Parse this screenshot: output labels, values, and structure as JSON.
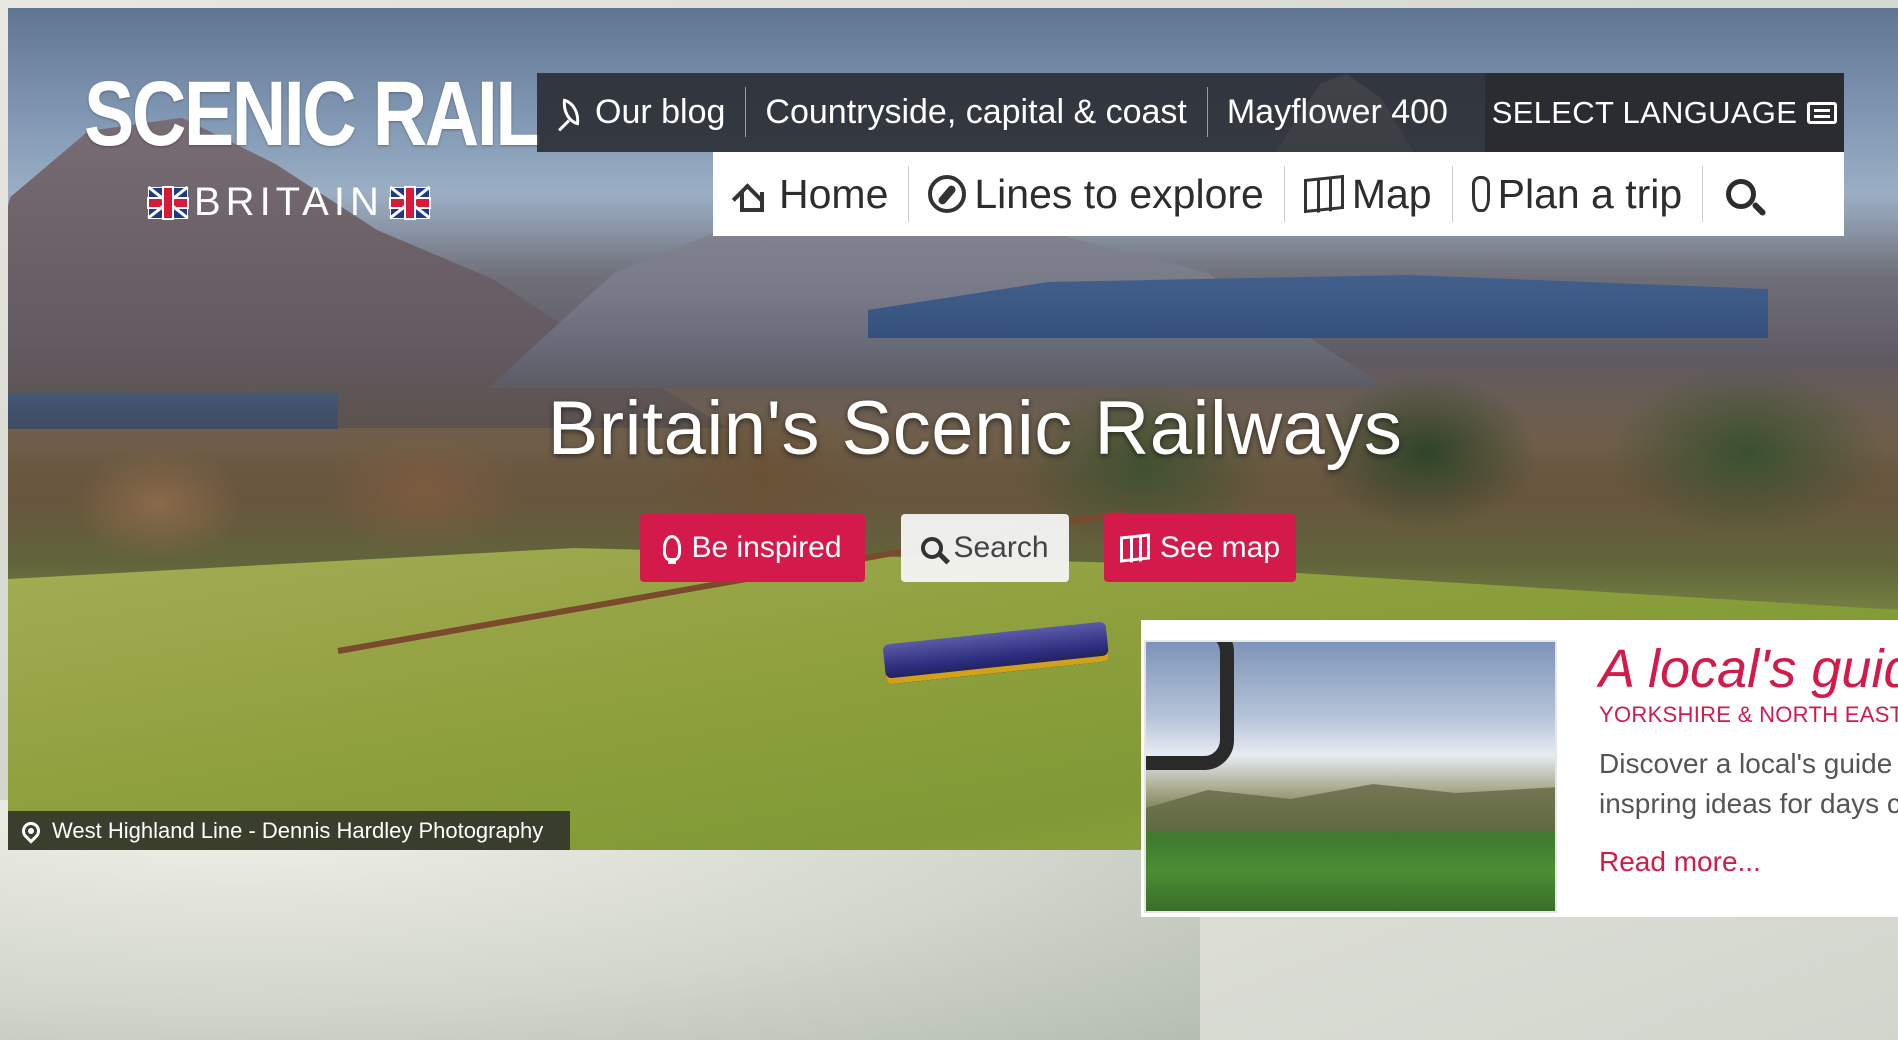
{
  "logo": {
    "title": "SCENIC RAIL",
    "subtitle": "BRITAIN"
  },
  "top_nav": {
    "items": [
      {
        "label": "Our blog",
        "icon": "feather-icon"
      },
      {
        "label": "Countryside, capital & coast"
      },
      {
        "label": "Mayflower 400"
      }
    ],
    "language_button": {
      "label": "SELECT LANGUAGE",
      "icon": "chat-icon"
    }
  },
  "main_nav": {
    "items": [
      {
        "label": "Home",
        "icon": "home-icon"
      },
      {
        "label": "Lines to explore",
        "icon": "compass-icon"
      },
      {
        "label": "Map",
        "icon": "map-icon"
      },
      {
        "label": "Plan a trip",
        "icon": "pen-icon"
      }
    ],
    "search_icon": "search-icon"
  },
  "hero": {
    "title": "Britain's Scenic Railways",
    "buttons": {
      "inspired": "Be inspired",
      "search": "Search",
      "map": "See map"
    },
    "caption": "West Highland Line - Dennis Hardley Photography"
  },
  "card": {
    "title": "A local's guid",
    "tag": "YORKSHIRE & NORTH EAST",
    "desc_line1": "Discover a local's guide",
    "desc_line2": "inspring ideas for days c",
    "link": "Read more..."
  },
  "colors": {
    "accent": "#d41a4a",
    "nav_dark": "#2a2c31",
    "nav_light": "#ffffff"
  }
}
